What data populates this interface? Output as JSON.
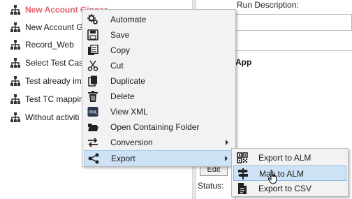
{
  "tree": {
    "items": [
      {
        "label": "New Account Ginger",
        "selected": true
      },
      {
        "label": "New Account Gi"
      },
      {
        "label": "Record_Web"
      },
      {
        "label": "Select Test Case"
      },
      {
        "label": "Test already imp"
      },
      {
        "label": "Test TC mapping"
      },
      {
        "label": "Without activiti"
      }
    ]
  },
  "right": {
    "run_description_label": "Run Description:",
    "app_label": "App",
    "edit_button": "Edit",
    "status_label": "Status:"
  },
  "context_menu": {
    "items": [
      {
        "label": "Automate",
        "icon": "gears-icon"
      },
      {
        "label": "Save",
        "icon": "save-icon"
      },
      {
        "label": "Copy",
        "icon": "copy-icon"
      },
      {
        "label": "Cut",
        "icon": "scissors-icon"
      },
      {
        "label": "Duplicate",
        "icon": "duplicate-icon"
      },
      {
        "label": "Delete",
        "icon": "trash-icon"
      },
      {
        "label": "View XML",
        "icon": "xml-icon"
      },
      {
        "label": "Open Containing Folder",
        "icon": "folder-open-icon"
      },
      {
        "label": "Conversion",
        "icon": "conversion-icon",
        "has_submenu": true
      },
      {
        "label": "Export",
        "icon": "share-icon",
        "has_submenu": true,
        "highlighted": true
      }
    ]
  },
  "export_submenu": {
    "items": [
      {
        "label": "Export to ALM",
        "icon": "qr-icon"
      },
      {
        "label": "Map to ALM",
        "icon": "signpost-icon",
        "hovered": true
      },
      {
        "label": "Export to CSV",
        "icon": "csv-file-icon"
      }
    ]
  },
  "colors": {
    "selected_text": "#e4606a",
    "menu_bg": "#f2f2f2",
    "highlight": "#cde3f5"
  }
}
